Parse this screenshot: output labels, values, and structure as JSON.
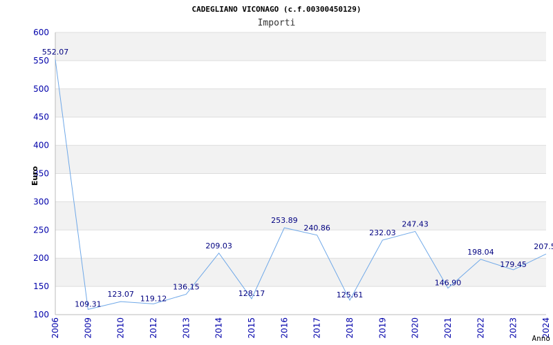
{
  "chart_data": {
    "type": "line",
    "title": "CADEGLIANO VICONAGO (c.f.00300450129)",
    "subtitle": "Importi",
    "xlabel": "Anno",
    "ylabel": "Euro",
    "categories": [
      "2006",
      "2009",
      "2010",
      "2012",
      "2013",
      "2014",
      "2015",
      "2016",
      "2017",
      "2018",
      "2019",
      "2020",
      "2021",
      "2022",
      "2023",
      "2024"
    ],
    "series": [
      {
        "values": [
          552.07,
          109.31,
          123.07,
          119.12,
          136.15,
          209.03,
          128.17,
          253.89,
          240.86,
          125.61,
          232.03,
          247.43,
          146.9,
          198.04,
          179.45,
          207.5
        ],
        "labels": [
          "552.07",
          "109.31",
          "123.07",
          "119.12",
          "136.15",
          "209.03",
          "128.17",
          "253.89",
          "240.86",
          "125.61",
          "232.03",
          "247.43",
          "146.90",
          "198.04",
          "179.45",
          "207.5"
        ]
      }
    ],
    "ylim": [
      100,
      600
    ],
    "yticks": [
      "100",
      "150",
      "200",
      "250",
      "300",
      "350",
      "400",
      "450",
      "500",
      "550",
      "600"
    ],
    "grid": true,
    "colors": {
      "line": "#6fa8e8",
      "band": "#f2f2f2",
      "tick": "#0000aa",
      "label": "#000080"
    }
  }
}
